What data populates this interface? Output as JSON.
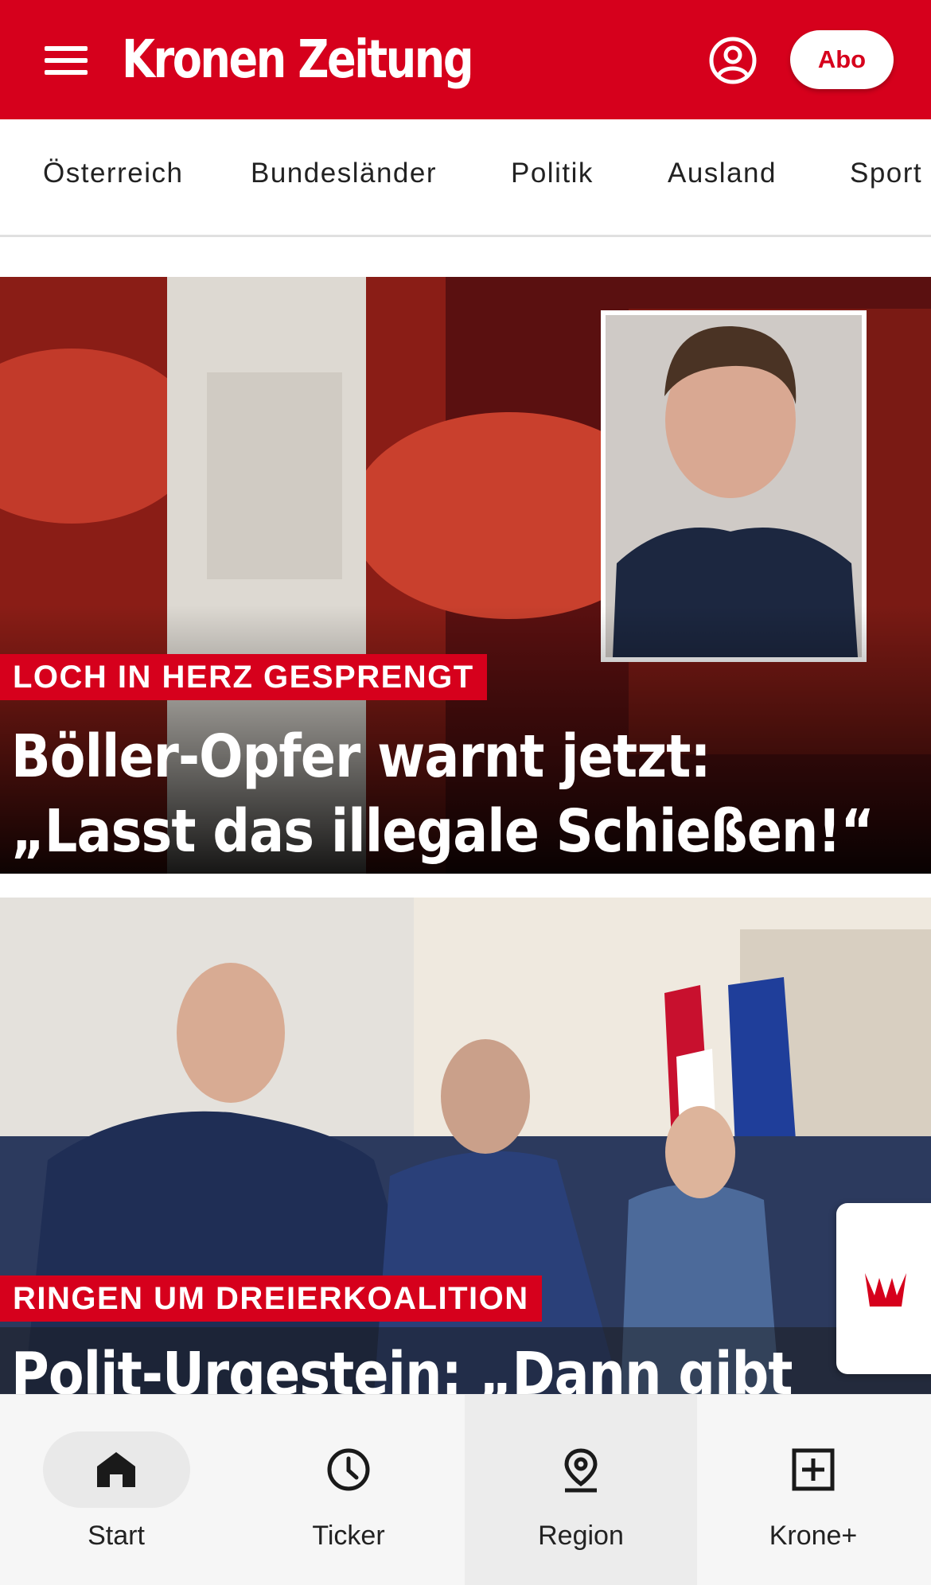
{
  "header": {
    "logo_text": "Kronen Zeitung",
    "abo_label": "Abo",
    "brand_color": "#d6001c",
    "icons": [
      "menu-icon",
      "user-account-icon"
    ]
  },
  "categories": [
    "Österreich",
    "Bundesländer",
    "Politik",
    "Ausland",
    "Sport"
  ],
  "articles": [
    {
      "kicker": "LOCH IN HERZ GESPRENGT",
      "headline_line1": "Böller-Opfer warnt jetzt:",
      "headline_line2": "„Lasst das illegale Schießen!“"
    },
    {
      "kicker": "RINGEN UM DREIERKOALITION",
      "headline_line1": "Polit-Urgestein: „Dann gibt"
    }
  ],
  "bottom_nav": {
    "active": "Start",
    "items": [
      {
        "label": "Start",
        "icon": "home-icon"
      },
      {
        "label": "Ticker",
        "icon": "clock-icon"
      },
      {
        "label": "Region",
        "icon": "location-pin-icon"
      },
      {
        "label": "Krone+",
        "icon": "plus-box-icon"
      }
    ]
  },
  "floating_tab": {
    "icon": "crown-icon"
  }
}
